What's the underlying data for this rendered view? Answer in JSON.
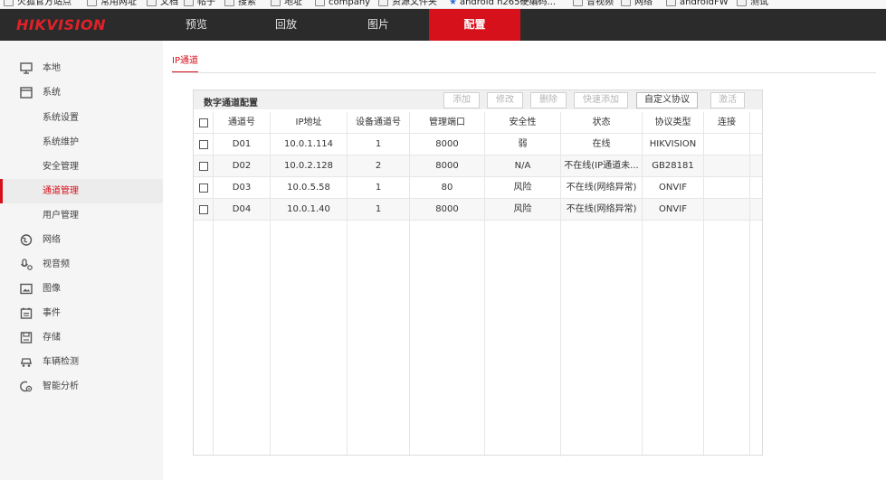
{
  "bookmarks": [
    {
      "label": "火狐官方站点",
      "type": "folder"
    },
    {
      "label": "常用网址",
      "type": "folder"
    },
    {
      "label": "文档",
      "type": "folder"
    },
    {
      "label": "帖子",
      "type": "folder"
    },
    {
      "label": "搜索",
      "type": "folder"
    },
    {
      "label": "地址",
      "type": "folder"
    },
    {
      "label": "company",
      "type": "folder"
    },
    {
      "label": "资源文件夹",
      "type": "folder"
    },
    {
      "label": "android h265硬编码...",
      "type": "starred"
    },
    {
      "label": "音视频",
      "type": "folder"
    },
    {
      "label": "网络",
      "type": "folder"
    },
    {
      "label": "androidFW",
      "type": "folder"
    },
    {
      "label": "测试",
      "type": "folder"
    }
  ],
  "brand": {
    "logo": "HIKVISION",
    "accent": "#d7111b"
  },
  "nav": {
    "tabs": [
      {
        "label": "预览",
        "active": false
      },
      {
        "label": "回放",
        "active": false
      },
      {
        "label": "图片",
        "active": false
      },
      {
        "label": "配置",
        "active": true
      }
    ]
  },
  "sidebar": {
    "items": [
      {
        "label": "本地",
        "icon": "monitor-icon",
        "sub": false
      },
      {
        "label": "系统",
        "icon": "window-icon",
        "sub": false
      },
      {
        "label": "系统设置",
        "sub": true
      },
      {
        "label": "系统维护",
        "sub": true
      },
      {
        "label": "安全管理",
        "sub": true
      },
      {
        "label": "通道管理",
        "sub": true,
        "active": true
      },
      {
        "label": "用户管理",
        "sub": true
      },
      {
        "label": "网络",
        "icon": "globe-icon",
        "sub": false
      },
      {
        "label": "视音频",
        "icon": "mic-icon",
        "sub": false
      },
      {
        "label": "图像",
        "icon": "image-icon",
        "sub": false
      },
      {
        "label": "事件",
        "icon": "calendar-icon",
        "sub": false
      },
      {
        "label": "存储",
        "icon": "storage-icon",
        "sub": false
      },
      {
        "label": "车辆检测",
        "icon": "car-icon",
        "sub": false
      },
      {
        "label": "智能分析",
        "icon": "analysis-icon",
        "sub": false
      }
    ]
  },
  "content": {
    "subtab": "IP通道",
    "panel": {
      "title": "数字通道配置",
      "buttons": [
        {
          "label": "添加",
          "enabled": false
        },
        {
          "label": "修改",
          "enabled": false
        },
        {
          "label": "删除",
          "enabled": false
        },
        {
          "label": "快速添加",
          "enabled": false
        },
        {
          "label": "自定义协议",
          "enabled": true
        },
        {
          "label": "激活",
          "enabled": false
        }
      ],
      "columns": [
        "通道号",
        "IP地址",
        "设备通道号",
        "管理端口",
        "安全性",
        "状态",
        "协议类型",
        "连接"
      ],
      "rows": [
        [
          "D01",
          "10.0.1.114",
          "1",
          "8000",
          "弱",
          "在线",
          "HIKVISION",
          ""
        ],
        [
          "D02",
          "10.0.2.128",
          "2",
          "8000",
          "N/A",
          "不在线(IP通道未...",
          "GB28181",
          ""
        ],
        [
          "D03",
          "10.0.5.58",
          "1",
          "80",
          "风险",
          "不在线(网络异常)",
          "ONVIF",
          ""
        ],
        [
          "D04",
          "10.0.1.40",
          "1",
          "8000",
          "风险",
          "不在线(网络异常)",
          "ONVIF",
          ""
        ]
      ]
    }
  }
}
